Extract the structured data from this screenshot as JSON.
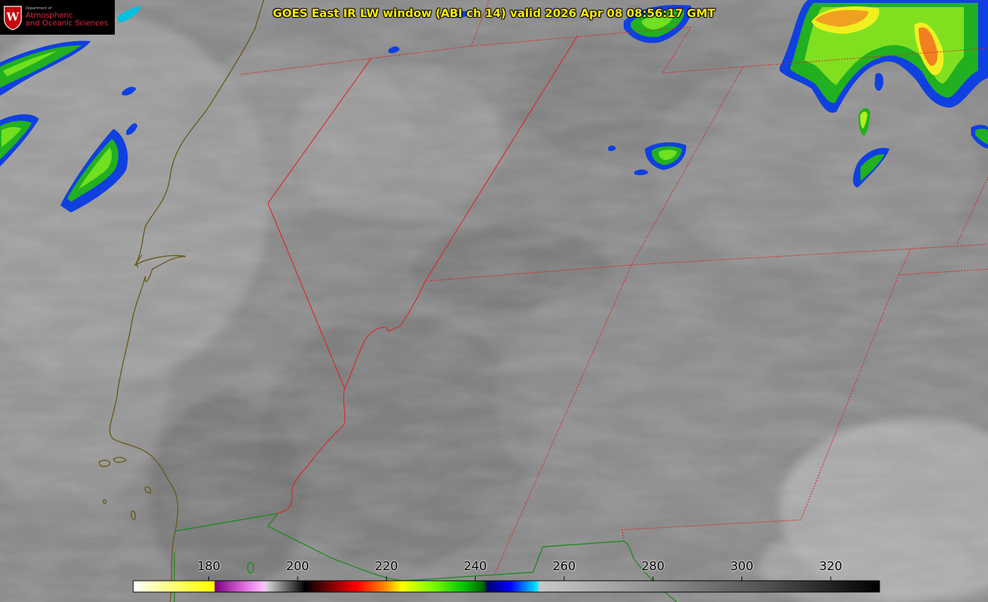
{
  "title": "GOES East IR LW window (ABI ch 14) valid 2026 Apr 08 08:56:17 GMT",
  "logo": {
    "line1": "Department of",
    "line2": "Atmospheric",
    "line3": "and Oceanic Sciences",
    "crest_letter": "W"
  },
  "colorbar": {
    "ticks": [
      "180",
      "200",
      "220",
      "240",
      "260",
      "280",
      "300",
      "320"
    ],
    "tick_values": [
      180,
      200,
      220,
      240,
      260,
      280,
      300,
      320
    ],
    "range": [
      163,
      331
    ]
  },
  "colors": {
    "state_border": "#e02020",
    "coastline": "#6b5a1a",
    "country_border": "#1e8a1e",
    "title_text": "#ffee00",
    "logo_text": "#d7263d"
  }
}
